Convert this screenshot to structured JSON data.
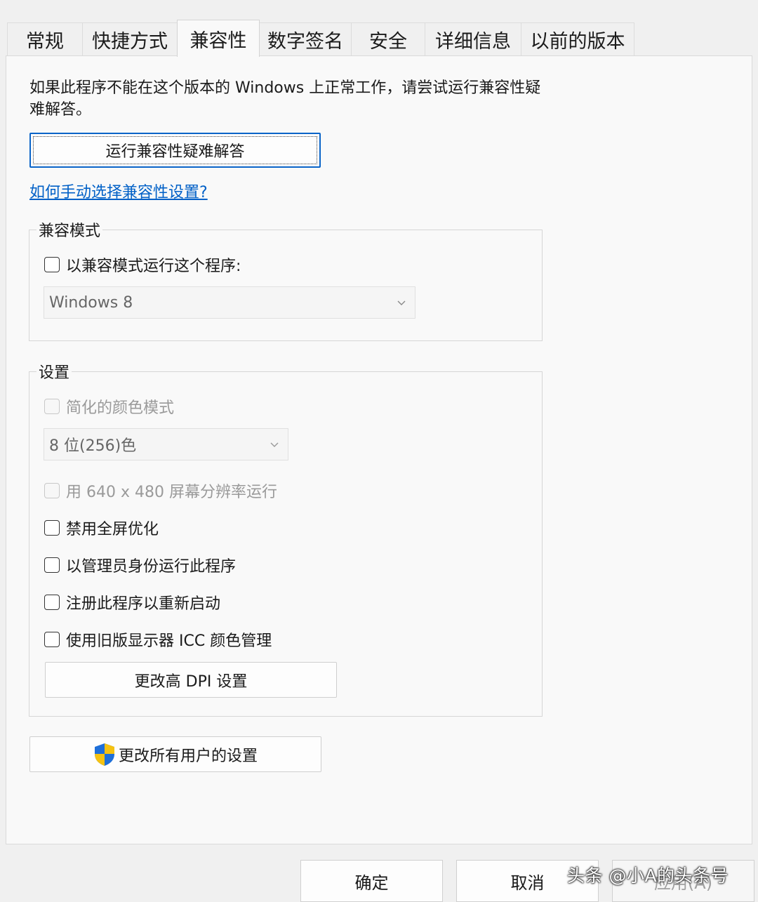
{
  "tabs": [
    {
      "label": "常规"
    },
    {
      "label": "快捷方式"
    },
    {
      "label": "兼容性"
    },
    {
      "label": "数字签名"
    },
    {
      "label": "安全"
    },
    {
      "label": "详细信息"
    },
    {
      "label": "以前的版本"
    }
  ],
  "intro_text": "如果此程序不能在这个版本的 Windows 上正常工作，请尝试运行兼容性疑难解答。",
  "troubleshoot_button": "运行兼容性疑难解答",
  "manual_link": "如何手动选择兼容性设置?",
  "compat_mode": {
    "legend": "兼容模式",
    "checkbox_label": "以兼容模式运行这个程序:",
    "os_selected": "Windows 8"
  },
  "settings": {
    "legend": "设置",
    "reduced_color": "简化的颜色模式",
    "color_depth_selected": "8 位(256)色",
    "res_640": "用 640 x 480 屏幕分辨率运行",
    "disable_fullscreen": "禁用全屏优化",
    "run_as_admin": "以管理员身份运行此程序",
    "register_restart": "注册此程序以重新启动",
    "legacy_icc": "使用旧版显示器 ICC 颜色管理",
    "dpi_button": "更改高 DPI 设置"
  },
  "all_users_button": "更改所有用户的设置",
  "footer": {
    "ok": "确定",
    "cancel": "取消",
    "apply": "应用(A)"
  },
  "watermark": "头条 @小A的头条号"
}
